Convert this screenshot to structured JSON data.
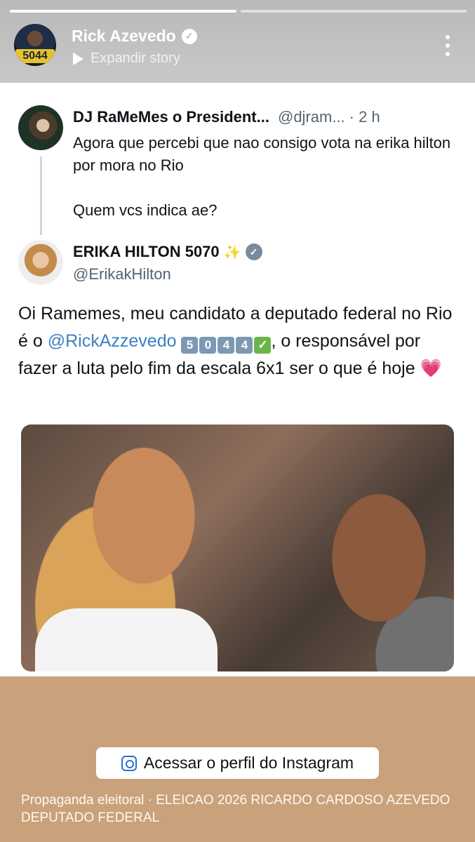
{
  "story": {
    "account_name": "Rick Azevedo",
    "avatar_number": "5044",
    "expand_label": "Expandir story",
    "progress_segments": 2,
    "progress_current": 1
  },
  "tweet": {
    "original": {
      "name": "DJ RaMeMes o President...",
      "handle": "@djram...",
      "time": "· 2 h",
      "lines": [
        "Agora que percebi que nao consigo vota na erika hilton por mora no Rio",
        "Quem vcs indica ae?"
      ]
    },
    "reply": {
      "name": "ERIKA HILTON 5070",
      "sparkle": "✨",
      "handle": "@ErikakHilton",
      "text_before": "Oi Ramemes, meu candidato a deputado federal no Rio é o",
      "mention": "@RickAzzevedo",
      "keycaps": [
        "5",
        "0",
        "4",
        "4",
        "✓"
      ],
      "text_after": ", o responsável por fazer a luta pelo fim da escala 6x1 ser o que é hoje",
      "heart": "💗"
    }
  },
  "footer": {
    "instagram_button": "Acessar o perfil do Instagram",
    "disclaimer": "Propaganda eleitoral · ELEICAO 2026 RICARDO CARDOSO AZEVEDO DEPUTADO FEDERAL"
  }
}
